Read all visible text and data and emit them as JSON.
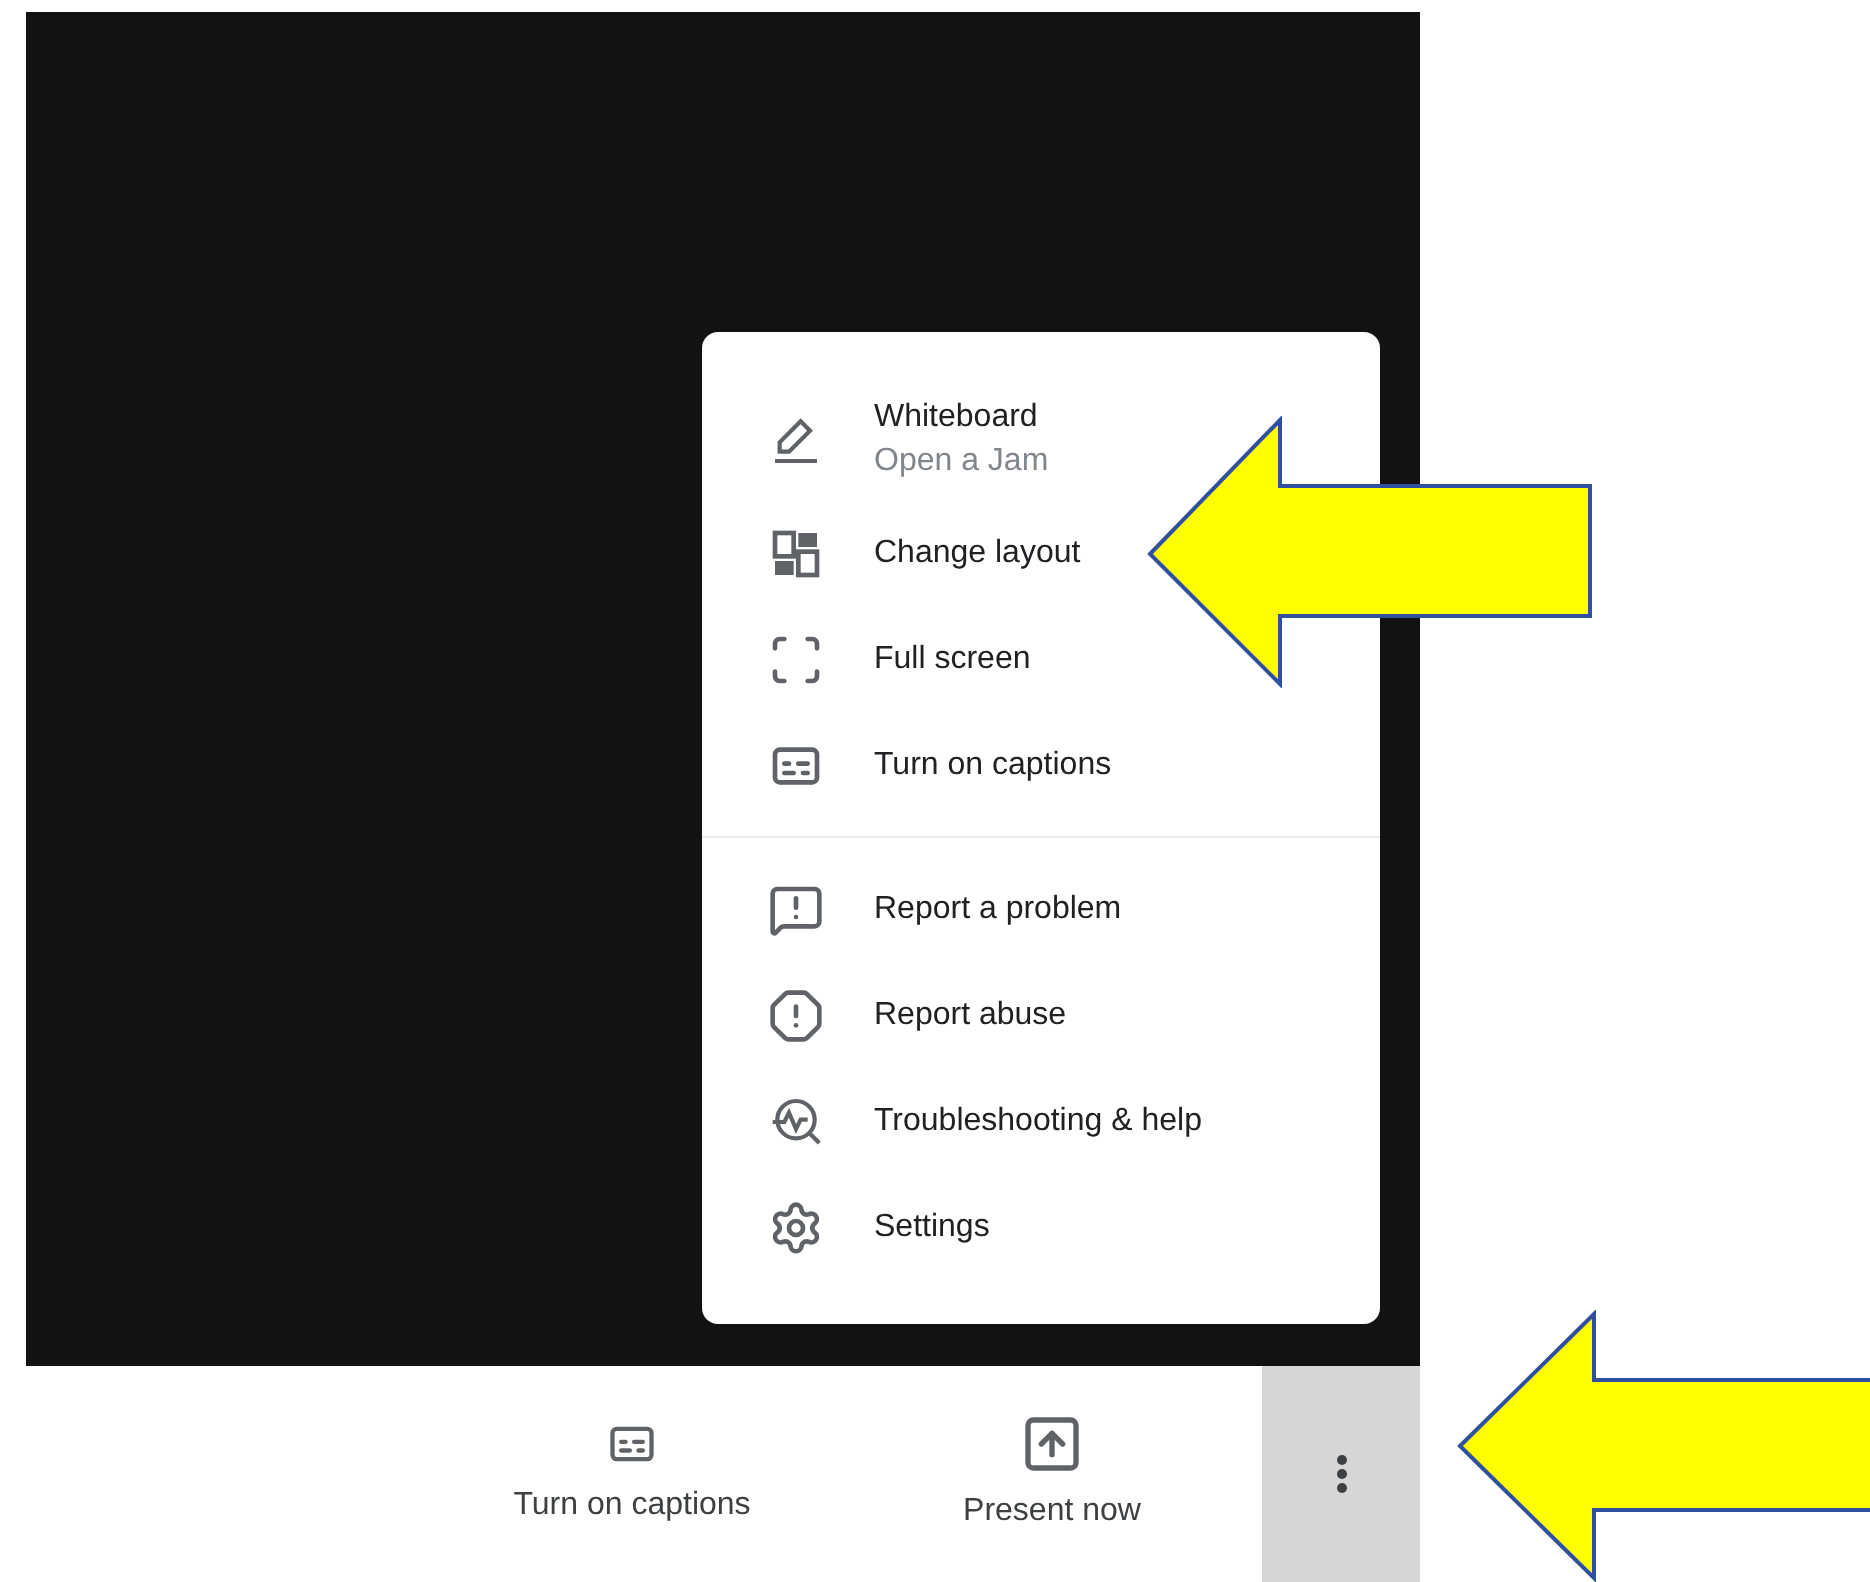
{
  "menu": {
    "sections": [
      [
        {
          "label": "Whiteboard",
          "sublabel": "Open a Jam"
        },
        {
          "label": "Change layout"
        },
        {
          "label": "Full screen"
        },
        {
          "label": "Turn on captions"
        }
      ],
      [
        {
          "label": "Report a problem"
        },
        {
          "label": "Report abuse"
        },
        {
          "label": "Troubleshooting & help"
        },
        {
          "label": "Settings"
        }
      ]
    ]
  },
  "toolbar": {
    "buttons": [
      {
        "kind": "captions",
        "label": "Turn on captions",
        "selected": false
      },
      {
        "kind": "present",
        "label": "Present now",
        "selected": false
      },
      {
        "kind": "more",
        "selected": true
      }
    ]
  }
}
